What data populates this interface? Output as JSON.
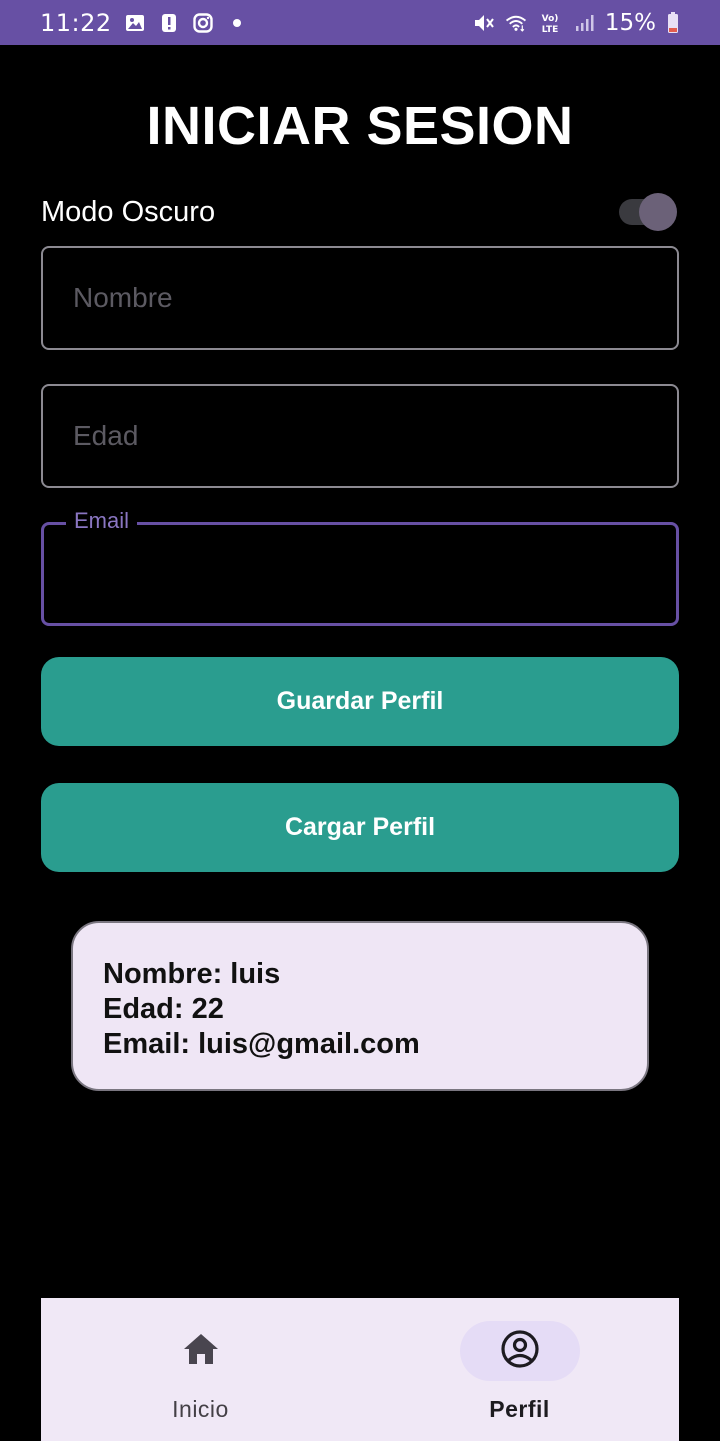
{
  "status_bar": {
    "time": "11:22",
    "battery": "15%",
    "left_icons": [
      "gallery-icon",
      "alert-icon",
      "instagram-icon",
      "dot-icon"
    ],
    "right_icons": [
      "mute-icon",
      "wifi-icon",
      "volte-icon",
      "signal-icon",
      "battery-icon"
    ],
    "volte_label": "Vo) LTE"
  },
  "page": {
    "title": "INICIAR SESION"
  },
  "dark_mode": {
    "label": "Modo Oscuro",
    "enabled": true
  },
  "form": {
    "name_placeholder": "Nombre",
    "age_placeholder": "Edad",
    "email_label": "Email",
    "email_value": ""
  },
  "buttons": {
    "save": "Guardar Perfil",
    "load": "Cargar Perfil"
  },
  "profile_card": {
    "name_line": "Nombre: luis",
    "age_line": "Edad: 22",
    "email_line": "Email: luis@gmail.com"
  },
  "bottom_nav": {
    "items": [
      {
        "label": "Inicio",
        "icon": "home-icon",
        "active": false
      },
      {
        "label": "Perfil",
        "icon": "account-circle-icon",
        "active": true
      }
    ]
  },
  "colors": {
    "status_bar": "#6750a4",
    "accent": "#6750a4",
    "button": "#2a9d8f",
    "card_bg": "#efe6f5",
    "nav_bg": "#f0e8f6"
  }
}
